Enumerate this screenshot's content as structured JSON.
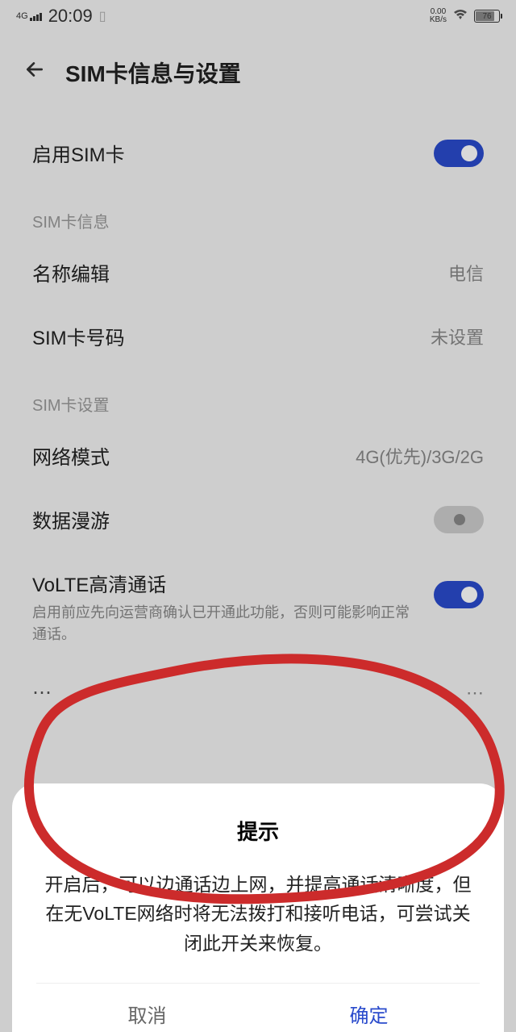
{
  "status": {
    "network_type": "4G",
    "time": "20:09",
    "speed_value": "0.00",
    "speed_unit": "KB/s",
    "battery_pct": "76"
  },
  "header": {
    "title": "SIM卡信息与设置"
  },
  "enable_sim": {
    "label": "启用SIM卡"
  },
  "section_info": "SIM卡信息",
  "name_edit": {
    "label": "名称编辑",
    "value": "电信"
  },
  "sim_number": {
    "label": "SIM卡号码",
    "value": "未设置"
  },
  "section_settings": "SIM卡设置",
  "network_mode": {
    "label": "网络模式",
    "value": "4G(优先)/3G/2G"
  },
  "roaming": {
    "label": "数据漫游"
  },
  "volte": {
    "label": "VoLTE高清通话",
    "sub": "启用前应先向运营商确认已开通此功能，否则可能影响正常通话。"
  },
  "dialog": {
    "title": "提示",
    "body": "开启后，可以边通话边上网，并提高通话清晰度，但在无VoLTE网络时将无法拨打和接听电话，可尝试关闭此开关来恢复。",
    "cancel": "取消",
    "confirm": "确定"
  }
}
